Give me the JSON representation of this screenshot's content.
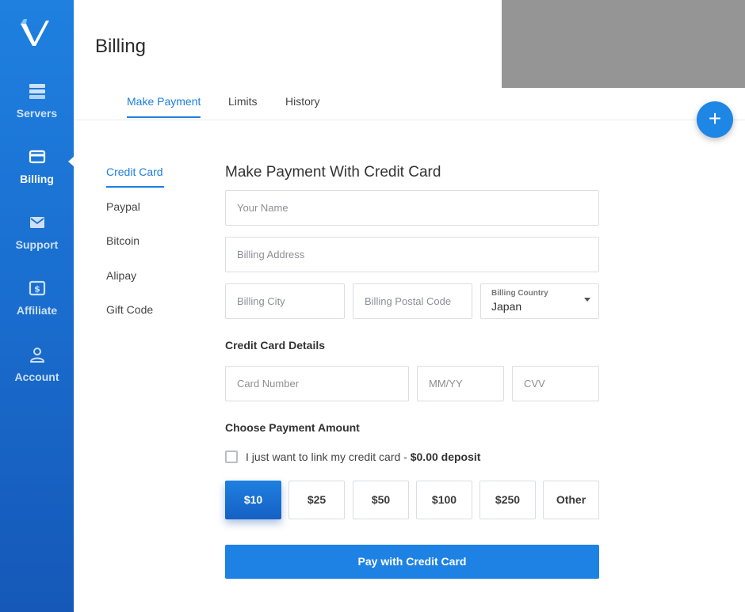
{
  "sidebar": {
    "logo_icon": "vultr-v-logo",
    "items": [
      {
        "label": "Servers",
        "icon": "server-icon",
        "active": false
      },
      {
        "label": "Billing",
        "icon": "credit-card-icon",
        "active": true
      },
      {
        "label": "Support",
        "icon": "envelope-icon",
        "active": false
      },
      {
        "label": "Affiliate",
        "icon": "dollar-icon",
        "active": false
      },
      {
        "label": "Account",
        "icon": "user-icon",
        "active": false
      }
    ]
  },
  "header": {
    "title": "Billing",
    "tabs": [
      {
        "label": "Make Payment",
        "active": true
      },
      {
        "label": "Limits",
        "active": false
      },
      {
        "label": "History",
        "active": false
      }
    ],
    "fab_label": "+"
  },
  "payment_methods": [
    {
      "label": "Credit Card",
      "active": true
    },
    {
      "label": "Paypal",
      "active": false
    },
    {
      "label": "Bitcoin",
      "active": false
    },
    {
      "label": "Alipay",
      "active": false
    },
    {
      "label": "Gift Code",
      "active": false
    }
  ],
  "form": {
    "title": "Make Payment With Credit Card",
    "name_placeholder": "Your Name",
    "address_placeholder": "Billing Address",
    "city_placeholder": "Billing City",
    "postal_placeholder": "Billing Postal Code",
    "country_label": "Billing Country",
    "country_value": "Japan",
    "card_section_title": "Credit Card Details",
    "card_number_placeholder": "Card Number",
    "expiry_placeholder": "MM/YY",
    "cvv_placeholder": "CVV",
    "amount_section_title": "Choose Payment Amount",
    "link_card_text": "I just want to link my credit card - ",
    "link_card_emphasis": "$0.00 deposit",
    "link_card_checked": false,
    "amounts": [
      {
        "label": "$10",
        "selected": true
      },
      {
        "label": "$25",
        "selected": false
      },
      {
        "label": "$50",
        "selected": false
      },
      {
        "label": "$100",
        "selected": false
      },
      {
        "label": "$250",
        "selected": false
      },
      {
        "label": "Other",
        "selected": false
      }
    ],
    "pay_button_label": "Pay with Credit Card"
  },
  "colors": {
    "accent": "#1e7ee0",
    "sidebar_top": "#1f80e0",
    "sidebar_bottom": "#1558b8"
  }
}
